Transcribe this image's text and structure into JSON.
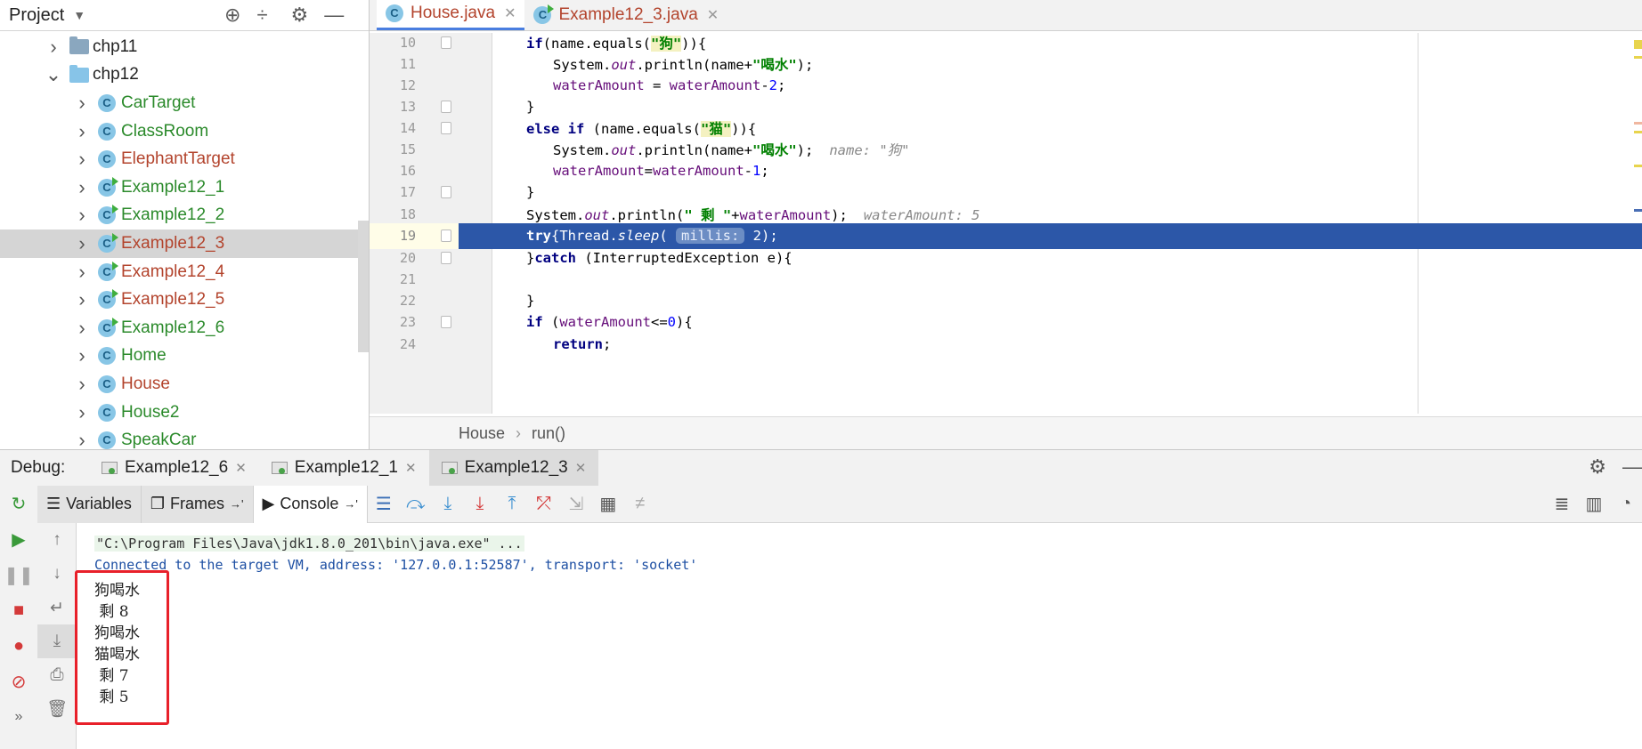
{
  "project": {
    "title": "Project",
    "tree": [
      {
        "label": "chp11",
        "type": "folder",
        "expanded": false,
        "indent": 60
      },
      {
        "label": "chp12",
        "type": "folder",
        "expanded": true,
        "indent": 60
      },
      {
        "label": "CarTarget",
        "type": "class",
        "color": "green",
        "runnable": false
      },
      {
        "label": "ClassRoom",
        "type": "class",
        "color": "green",
        "runnable": false
      },
      {
        "label": "ElephantTarget",
        "type": "class",
        "color": "red",
        "runnable": false
      },
      {
        "label": "Example12_1",
        "type": "class",
        "color": "green",
        "runnable": true
      },
      {
        "label": "Example12_2",
        "type": "class",
        "color": "green",
        "runnable": true
      },
      {
        "label": "Example12_3",
        "type": "class",
        "color": "red",
        "runnable": true,
        "selected": true
      },
      {
        "label": "Example12_4",
        "type": "class",
        "color": "red",
        "runnable": true
      },
      {
        "label": "Example12_5",
        "type": "class",
        "color": "red",
        "runnable": true
      },
      {
        "label": "Example12_6",
        "type": "class",
        "color": "green",
        "runnable": true
      },
      {
        "label": "Home",
        "type": "class",
        "color": "green",
        "runnable": false
      },
      {
        "label": "House",
        "type": "class",
        "color": "red",
        "runnable": false
      },
      {
        "label": "House2",
        "type": "class",
        "color": "green",
        "runnable": false
      },
      {
        "label": "SpeakCar",
        "type": "class",
        "color": "green",
        "runnable": false
      }
    ]
  },
  "editor": {
    "tabs": [
      {
        "label": "House.java",
        "active": true
      },
      {
        "label": "Example12_3.java",
        "active": false
      }
    ],
    "line_numbers": [
      "10",
      "11",
      "12",
      "13",
      "14",
      "15",
      "16",
      "17",
      "18",
      "19",
      "20",
      "21",
      "22",
      "23",
      "24"
    ],
    "current_line": "19",
    "breadcrumb": [
      "House",
      "run()"
    ],
    "hints": {
      "name": "name: \"狗\"",
      "water": "waterAmount: 5",
      "millis": "millis:"
    }
  },
  "debug": {
    "title": "Debug:",
    "sessions": [
      {
        "label": "Example12_6",
        "active": false
      },
      {
        "label": "Example12_1",
        "active": false
      },
      {
        "label": "Example12_3",
        "active": true
      }
    ],
    "panel_tabs": [
      {
        "label": "Variables",
        "active": false
      },
      {
        "label": "Frames",
        "active": false
      },
      {
        "label": "Console",
        "active": true
      }
    ],
    "console": {
      "command": "\"C:\\Program Files\\Java\\jdk1.8.0_201\\bin\\java.exe\" ...",
      "connected": "Connected to the target VM, address: '127.0.0.1:52587', transport: 'socket'",
      "output": [
        "狗喝水",
        " 剩 8",
        "狗喝水",
        "猫喝水",
        " 剩 7",
        " 剩 5"
      ]
    }
  },
  "colors": {
    "current_line": "#2c57a8",
    "highlight_box": "#e8202a",
    "class_green": "#2b8a2b",
    "class_red": "#b3442d"
  }
}
